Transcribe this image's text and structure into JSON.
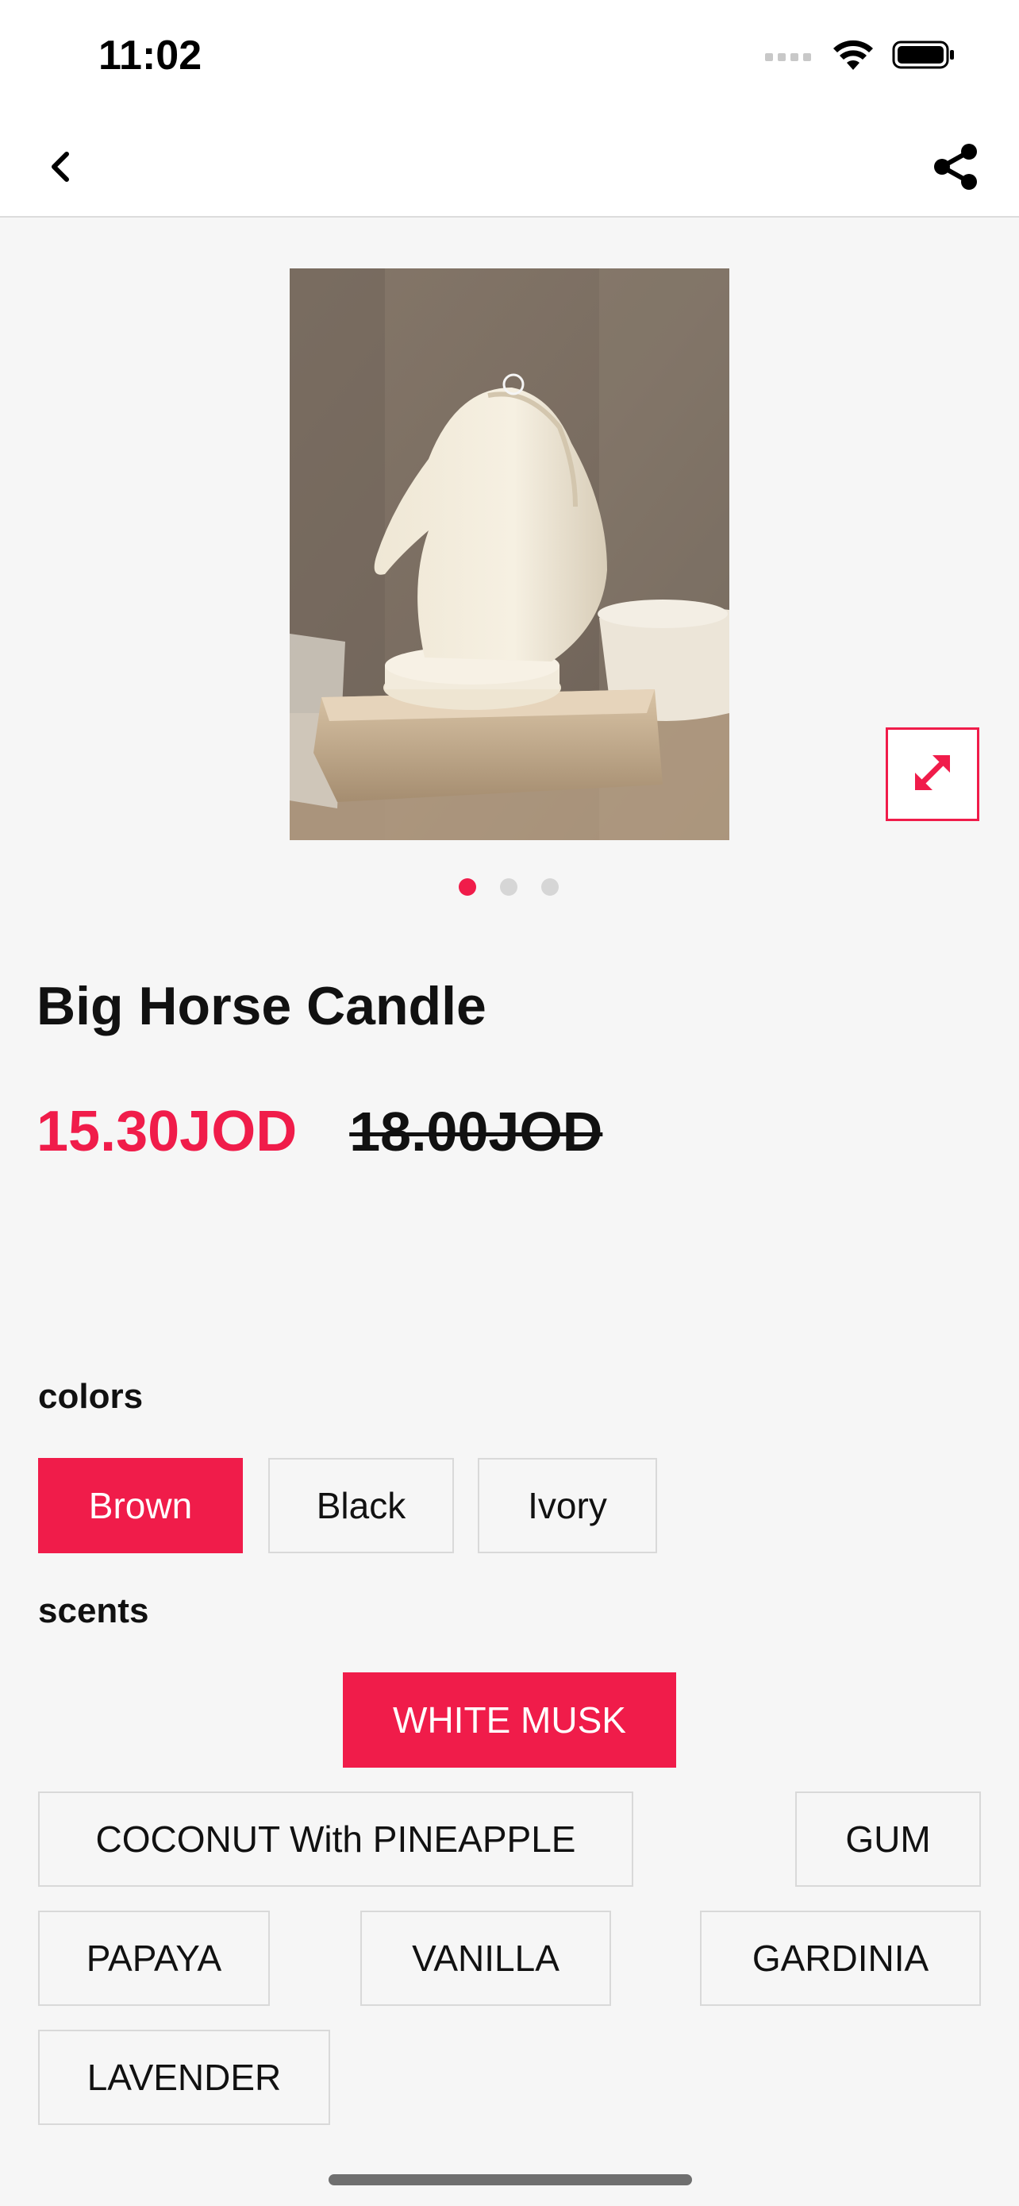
{
  "status_bar": {
    "time": "11:02"
  },
  "product": {
    "title": "Big Horse Candle",
    "price_sale": "15.30JOD",
    "price_original": "18.00JOD",
    "image_count": 3,
    "active_image": 1
  },
  "colors": {
    "label": "colors",
    "options": [
      "Brown",
      "Black",
      "Ivory"
    ],
    "selected": "Brown"
  },
  "scents": {
    "label": "scents",
    "options": [
      "WHITE MUSK",
      "COCONUT With PINEAPPLE",
      "GUM",
      "PAPAYA",
      "VANILLA",
      "GARDINIA",
      "LAVENDER"
    ],
    "selected": "WHITE MUSK"
  },
  "theme": {
    "accent": "#f01c4a",
    "background": "#f6f6f6"
  }
}
